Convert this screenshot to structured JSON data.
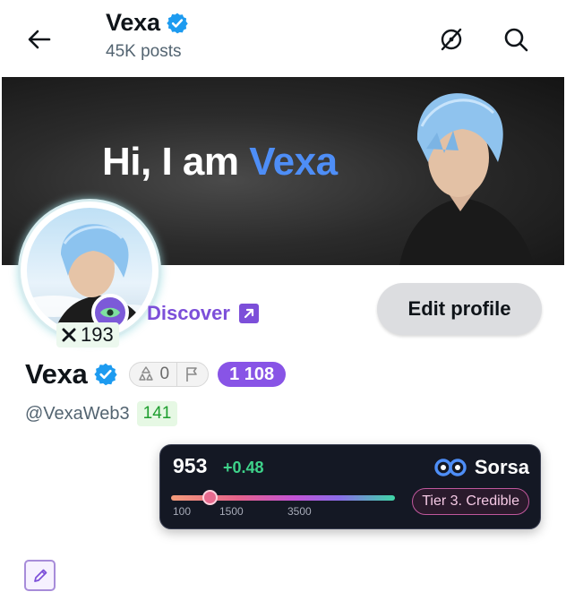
{
  "header": {
    "title": "Vexa",
    "posts": "45K posts"
  },
  "banner": {
    "greeting": "Hi, I am ",
    "highlight": "Vexa"
  },
  "profile": {
    "score_badge": "193",
    "discover_label": "Discover",
    "edit_button": "Edit profile",
    "name": "Vexa",
    "recycle_count": "0",
    "purple_badge": "1 108",
    "handle": "@VexaWeb3",
    "green_badge": "141"
  },
  "sorsa": {
    "score": "953",
    "delta": "+0.48",
    "brand": "Sorsa",
    "tier": "Tier 3. Credible",
    "ticks": [
      "100",
      "1500",
      "3500"
    ],
    "slider_fraction": 0.17
  },
  "colors": {
    "verified": "#1d9bf0",
    "accent_purple": "#7c4fd9",
    "delta_green": "#3ed28a"
  }
}
